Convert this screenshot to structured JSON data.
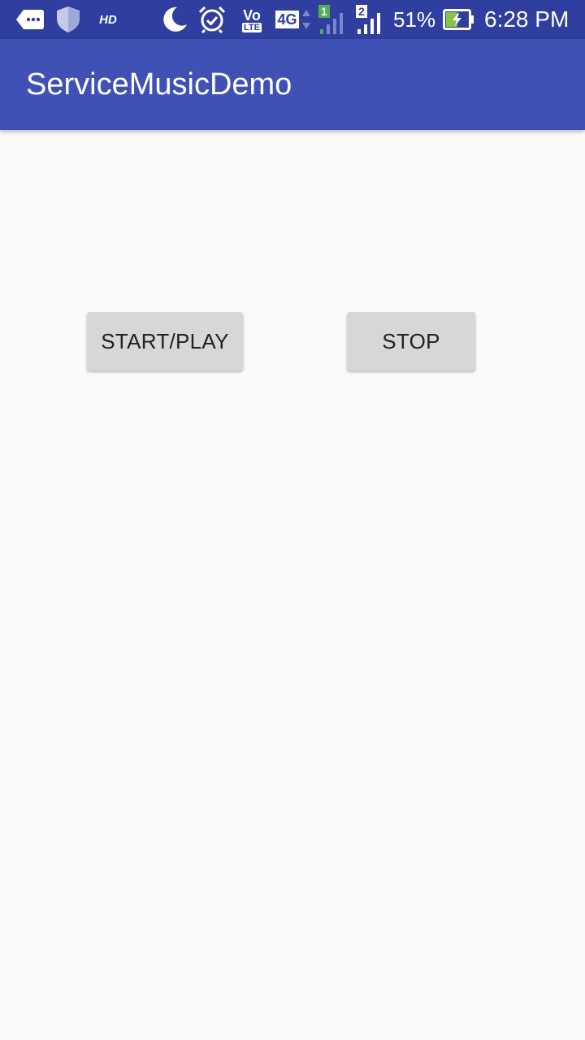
{
  "status_bar": {
    "background": "#303f9f",
    "left_icons": [
      "message-dots-icon",
      "shield-icon"
    ],
    "hd_label": "HD",
    "right_icons": [
      "moon-icon",
      "alarm-icon",
      "volte-icon",
      "network-4g-icon",
      "sim1-signal-icon",
      "sim2-signal-icon",
      "battery-charging-icon"
    ],
    "volte_top": "Vo",
    "volte_bottom": "LTE",
    "network_label": "4G",
    "sim1_label": "1",
    "sim2_label": "2",
    "battery_percent": "51%",
    "battery_level": 0.51,
    "time": "6:28 PM"
  },
  "app_bar": {
    "title": "ServiceMusicDemo",
    "background": "#3f51b5"
  },
  "content": {
    "background": "#fafafa",
    "start_button_label": "START/PLAY",
    "stop_button_label": "STOP",
    "button_color": "#d6d7d7"
  }
}
